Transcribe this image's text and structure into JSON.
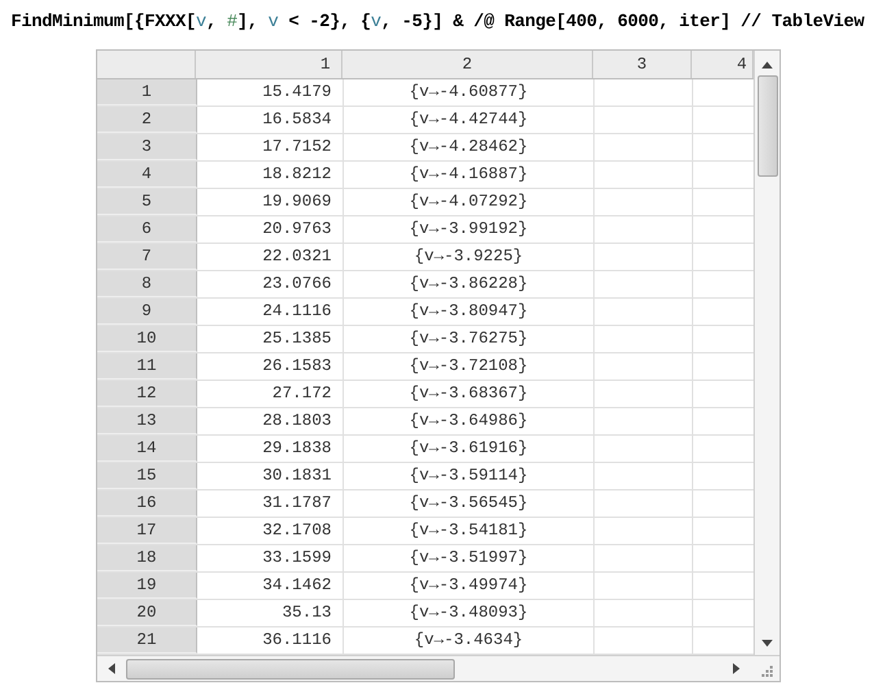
{
  "input": [
    {
      "kind": "plain",
      "text": "FindMinimum[{FXXX["
    },
    {
      "kind": "var",
      "text": "v"
    },
    {
      "kind": "plain",
      "text": ", "
    },
    {
      "kind": "slot",
      "text": "#"
    },
    {
      "kind": "plain",
      "text": "], "
    },
    {
      "kind": "var",
      "text": "v"
    },
    {
      "kind": "plain",
      "text": " < -2}, {"
    },
    {
      "kind": "var",
      "text": "v"
    },
    {
      "kind": "plain",
      "text": ", -5}] & /@ Range[400, 6000, iter] // TableView"
    }
  ],
  "table": {
    "columns": [
      "1",
      "2",
      "3",
      "4"
    ],
    "rows": [
      {
        "label": "1",
        "cells": [
          "15.4179",
          "{v→-4.60877}"
        ]
      },
      {
        "label": "2",
        "cells": [
          "16.5834",
          "{v→-4.42744}"
        ]
      },
      {
        "label": "3",
        "cells": [
          "17.7152",
          "{v→-4.28462}"
        ]
      },
      {
        "label": "4",
        "cells": [
          "18.8212",
          "{v→-4.16887}"
        ]
      },
      {
        "label": "5",
        "cells": [
          "19.9069",
          "{v→-4.07292}"
        ]
      },
      {
        "label": "6",
        "cells": [
          "20.9763",
          "{v→-3.99192}"
        ]
      },
      {
        "label": "7",
        "cells": [
          "22.0321",
          "{v→-3.9225}"
        ]
      },
      {
        "label": "8",
        "cells": [
          "23.0766",
          "{v→-3.86228}"
        ]
      },
      {
        "label": "9",
        "cells": [
          "24.1116",
          "{v→-3.80947}"
        ]
      },
      {
        "label": "10",
        "cells": [
          "25.1385",
          "{v→-3.76275}"
        ]
      },
      {
        "label": "11",
        "cells": [
          "26.1583",
          "{v→-3.72108}"
        ]
      },
      {
        "label": "12",
        "cells": [
          "27.172",
          "{v→-3.68367}"
        ]
      },
      {
        "label": "13",
        "cells": [
          "28.1803",
          "{v→-3.64986}"
        ]
      },
      {
        "label": "14",
        "cells": [
          "29.1838",
          "{v→-3.61916}"
        ]
      },
      {
        "label": "15",
        "cells": [
          "30.1831",
          "{v→-3.59114}"
        ]
      },
      {
        "label": "16",
        "cells": [
          "31.1787",
          "{v→-3.56545}"
        ]
      },
      {
        "label": "17",
        "cells": [
          "32.1708",
          "{v→-3.54181}"
        ]
      },
      {
        "label": "18",
        "cells": [
          "33.1599",
          "{v→-3.51997}"
        ]
      },
      {
        "label": "19",
        "cells": [
          "34.1462",
          "{v→-3.49974}"
        ]
      },
      {
        "label": "20",
        "cells": [
          "35.13",
          "{v→-3.48093}"
        ]
      },
      {
        "label": "21",
        "cells": [
          "36.1116",
          "{v→-3.4634}"
        ]
      }
    ]
  }
}
